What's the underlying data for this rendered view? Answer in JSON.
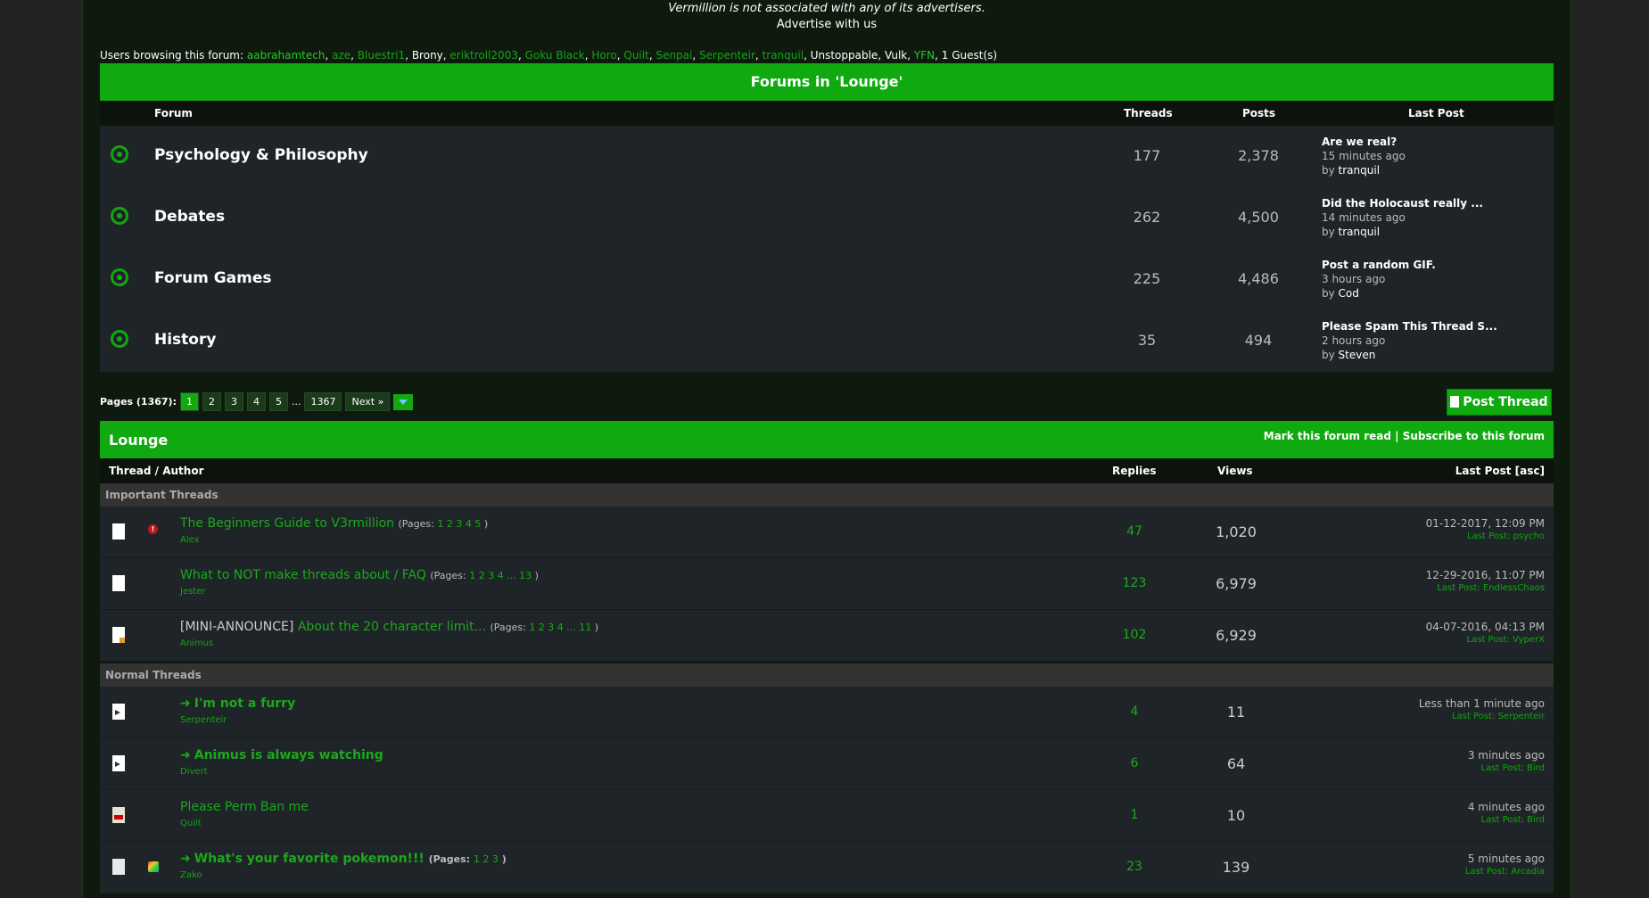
{
  "header": {
    "disclaimer": "Vermillion is not associated with any of its advertisers.",
    "advertise": "Advertise with us"
  },
  "browsing": {
    "label": "Users browsing this forum:",
    "users": [
      "aabrahamtech",
      "aze",
      "Bluestri1",
      "Brony",
      "eriktroll2003",
      "Goku Black",
      "Horo",
      "Quilt",
      "Senpai",
      "Serpenteir",
      "tranquil",
      "Unstoppable",
      "Vulk",
      "YFN"
    ],
    "guests": "1 Guest(s)"
  },
  "forums": {
    "title": "Forums in 'Lounge'",
    "cols": {
      "forum": "Forum",
      "threads": "Threads",
      "posts": "Posts",
      "last_post": "Last Post"
    },
    "rows": [
      {
        "name": "Psychology & Philosophy",
        "threads": "177",
        "posts": "2,378",
        "lp_title": "Are we real?",
        "lp_time": "15 minutes ago",
        "lp_by": "by",
        "lp_user": "tranquil"
      },
      {
        "name": "Debates",
        "threads": "262",
        "posts": "4,500",
        "lp_title": "Did the Holocaust really ...",
        "lp_time": "14 minutes ago",
        "lp_by": "by",
        "lp_user": "tranquil"
      },
      {
        "name": "Forum Games",
        "threads": "225",
        "posts": "4,486",
        "lp_title": "Post a random GIF.",
        "lp_time": "3 hours ago",
        "lp_by": "by",
        "lp_user": "Cod"
      },
      {
        "name": "History",
        "threads": "35",
        "posts": "494",
        "lp_title": "Please Spam This Thread S...",
        "lp_time": "2 hours ago",
        "lp_by": "by",
        "lp_user": "Steven"
      }
    ]
  },
  "pagination": {
    "label": "Pages (1367):",
    "pages": [
      "1",
      "2",
      "3",
      "4",
      "5"
    ],
    "ellipsis": "...",
    "last": "1367",
    "next": "Next »"
  },
  "post_thread": "Post Thread",
  "lounge": {
    "title": "Lounge",
    "mark_read": "Mark this forum read",
    "sep": "|",
    "subscribe": "Subscribe to this forum",
    "cols": {
      "thread": "Thread / Author",
      "replies": "Replies",
      "views": "Views",
      "last_post": "Last Post [asc]"
    },
    "important_label": "Important Threads",
    "normal_label": "Normal Threads",
    "important": [
      {
        "prefix": "",
        "title": "The Beginners Guide to V3rmillion",
        "pages_label": "(Pages:",
        "pages": "1 2 3 4 5",
        "pages_end": ")",
        "author": "Alex",
        "replies": "47",
        "views": "1,020",
        "date": "01-12-2017, 12:09 PM",
        "lp_label": "Last Post:",
        "lp_user": "psycho",
        "icon": "doc",
        "prio": true
      },
      {
        "prefix": "",
        "title": "What to NOT make threads about / FAQ",
        "pages_label": "(Pages:",
        "pages": "1 2 3 4 ... 13",
        "pages_end": ")",
        "author": "Jester",
        "replies": "123",
        "views": "6,979",
        "date": "12-29-2016, 11:07 PM",
        "lp_label": "Last Post:",
        "lp_user": "EndlessChaos",
        "icon": "doc",
        "prio": false
      },
      {
        "prefix": "[MINI-ANNOUNCE]",
        "title": "About the 20 character limit...",
        "pages_label": "(Pages:",
        "pages": "1 2 3 4 ... 11",
        "pages_end": ")",
        "author": "Animus",
        "replies": "102",
        "views": "6,929",
        "date": "04-07-2016, 04:13 PM",
        "lp_label": "Last Post:",
        "lp_user": "VyperX",
        "icon": "fire",
        "prio": false
      }
    ],
    "normal": [
      {
        "title": "I'm not a furry",
        "author": "Serpenteir",
        "replies": "4",
        "views": "11",
        "date": "Less than 1 minute ago",
        "lp_label": "Last Post:",
        "lp_user": "Serpenteir",
        "icon": "arrow",
        "bold": true,
        "pages": ""
      },
      {
        "title": "Animus is always watching",
        "author": "Divert",
        "replies": "6",
        "views": "64",
        "date": "3 minutes ago",
        "lp_label": "Last Post:",
        "lp_user": "Bird",
        "icon": "arrow",
        "bold": true,
        "pages": ""
      },
      {
        "title": "Please Perm Ban me",
        "author": "Quilt",
        "replies": "1",
        "views": "10",
        "date": "4 minutes ago",
        "lp_label": "Last Post:",
        "lp_user": "Bird",
        "icon": "paper",
        "bold": false,
        "pages": ""
      },
      {
        "title": "What's your favorite pokemon!!!",
        "author": "Zako",
        "replies": "23",
        "views": "139",
        "date": "5 minutes ago",
        "lp_label": "Last Post:",
        "lp_user": "Arcadia",
        "icon": "lines",
        "bold": true,
        "pages_label": "(Pages:",
        "pages": "1 2 3",
        "pages_end": ")"
      }
    ]
  }
}
